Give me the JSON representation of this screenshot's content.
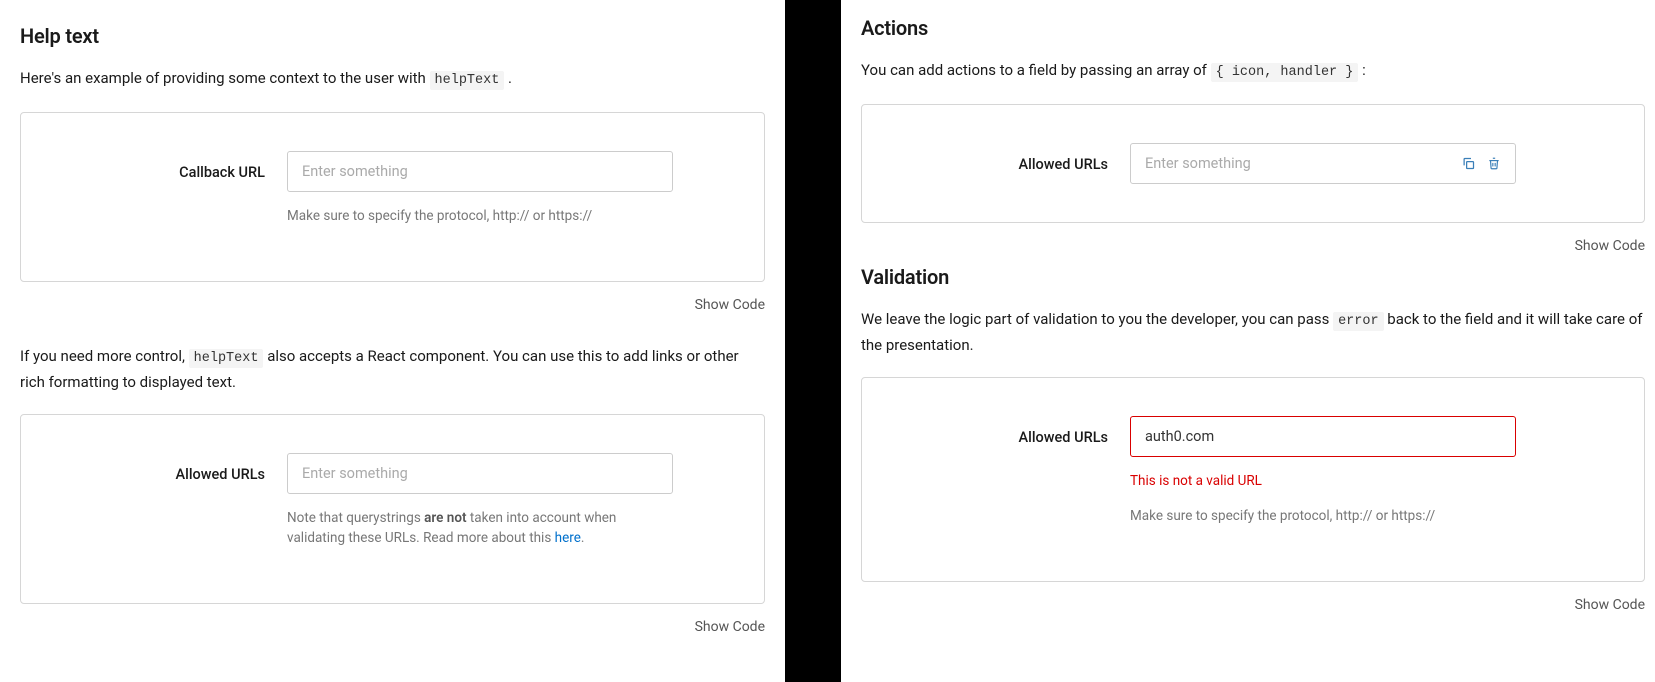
{
  "left": {
    "help_text": {
      "title": "Help text",
      "desc_pre": "Here's an example of providing some context to the user with ",
      "desc_code": "helpText",
      "desc_post": " .",
      "example1": {
        "field_label": "Callback URL",
        "placeholder": "Enter something",
        "help": "Make sure to specify the protocol, http:// or https://"
      },
      "show_code": "Show Code",
      "para2_pre": "If you need more control, ",
      "para2_code": "helpText",
      "para2_post": " also accepts a React component. You can use this to add links or other rich formatting to displayed text.",
      "example2": {
        "field_label": "Allowed URLs",
        "placeholder": "Enter something",
        "help_pre": "Note that querystrings ",
        "help_bold": "are not",
        "help_mid": " taken into account when validating these URLs. Read more about this ",
        "help_link": "here",
        "help_post": "."
      },
      "show_code2": "Show Code"
    }
  },
  "right": {
    "actions": {
      "title": "Actions",
      "desc_pre": "You can add actions to a field by passing an array of ",
      "desc_code": "{ icon, handler }",
      "desc_post": " :",
      "example": {
        "field_label": "Allowed URLs",
        "placeholder": "Enter something"
      },
      "show_code": "Show Code"
    },
    "validation": {
      "title": "Validation",
      "desc_pre": "We leave the logic part of validation to you the developer, you can pass ",
      "desc_code": "error",
      "desc_post": " back to the field and it will take care of the presentation.",
      "example": {
        "field_label": "Allowed URLs",
        "value": "auth0.com",
        "error_text": "This is not a valid URL",
        "help": "Make sure to specify the protocol, http:// or https://"
      },
      "show_code": "Show Code"
    }
  }
}
